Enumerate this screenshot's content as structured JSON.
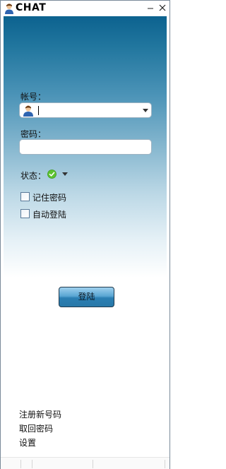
{
  "window": {
    "title": "CHAT",
    "minimize_glyph": "—",
    "close_glyph": "×"
  },
  "login": {
    "account_label": "帐号：",
    "account_value": "",
    "password_label": "密码：",
    "password_value": "",
    "status_label": "状态：",
    "status_icon": "online-check-icon",
    "remember_password_label": "记住密码",
    "remember_password_checked": false,
    "auto_login_label": "自动登陆",
    "auto_login_checked": false,
    "login_button_label": "登陆"
  },
  "links": {
    "register": "注册新号码",
    "recover_password": "取回密码",
    "settings": "设置"
  },
  "colors": {
    "header_gradient_top": "#0c628f",
    "status_online": "#5cc22f",
    "button_blue": "#2b7fb3"
  }
}
